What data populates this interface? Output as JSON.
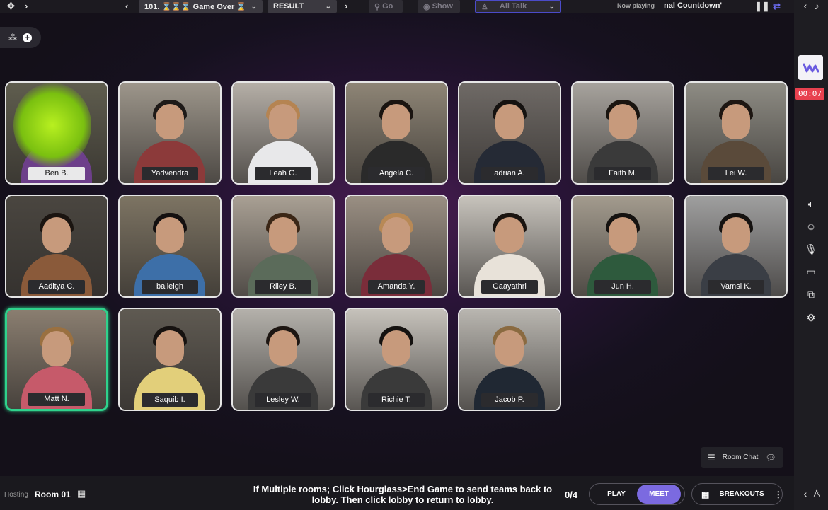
{
  "topbar": {
    "activity": "101. ⌛⌛⌛ Game Over ⌛",
    "phase": "RESULT",
    "go_label": "Go",
    "show_label": "Show",
    "talk_label": "All Talk",
    "now_playing_label": "Now playing",
    "now_playing_title": "nal Countdown'"
  },
  "sidebar": {
    "timer": "00:07"
  },
  "participants": [
    {
      "name": "Ben B."
    },
    {
      "name": "Yadvendra"
    },
    {
      "name": "Leah G."
    },
    {
      "name": "Angela C."
    },
    {
      "name": "adrian A."
    },
    {
      "name": "Faith M."
    },
    {
      "name": "Lei W."
    },
    {
      "name": "Aaditya C."
    },
    {
      "name": "baileigh"
    },
    {
      "name": "Riley B."
    },
    {
      "name": "Amanda Y."
    },
    {
      "name": "Gaayathri"
    },
    {
      "name": "Jun H."
    },
    {
      "name": "Vamsi K."
    },
    {
      "name": "Matt N."
    },
    {
      "name": "Saquib I."
    },
    {
      "name": "Lesley W."
    },
    {
      "name": "Richie T."
    },
    {
      "name": "Jacob P."
    }
  ],
  "room_chat": {
    "label": "Room Chat"
  },
  "bottombar": {
    "hosting_label": "Hosting",
    "room_name": "Room 01",
    "instruction": "If Multiple rooms; Click Hourglass>End Game to send teams back to lobby. Then click lobby to return to lobby.",
    "count": "0/4",
    "play_label": "PLAY",
    "meet_label": "MEET",
    "breakouts_label": "BREAKOUTS"
  },
  "colors": {
    "accent": "#7b6ae0",
    "timer": "#e8414f",
    "active_border": "#2fd28c"
  }
}
